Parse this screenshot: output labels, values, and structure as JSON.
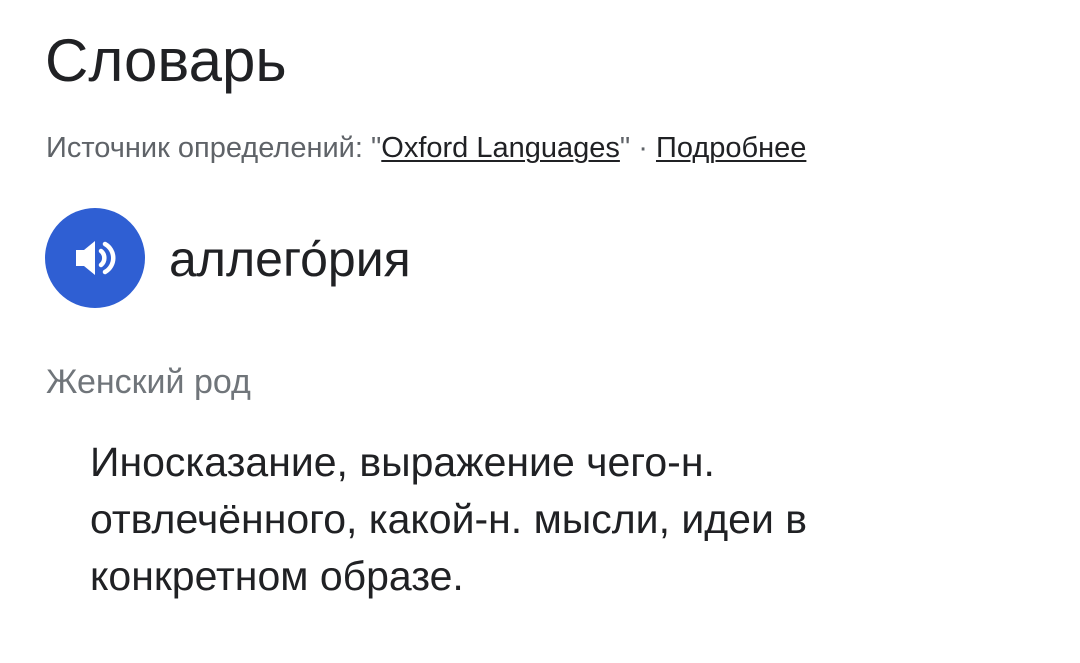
{
  "header": {
    "title": "Словарь"
  },
  "source": {
    "prefix": "Источник определений: \"",
    "link_label": "Oxford Languages",
    "suffix": "\"",
    "separator": " · ",
    "more_label": "Подробнее"
  },
  "entry": {
    "speaker_icon": "volume-icon",
    "speaker_color": "#2f5fd3",
    "word": "аллего́рия",
    "gender": "Женский род",
    "definition": "Иносказание, выражение чего-н. отвлечённого, какой-н. мысли, идеи в конкретном образе."
  }
}
